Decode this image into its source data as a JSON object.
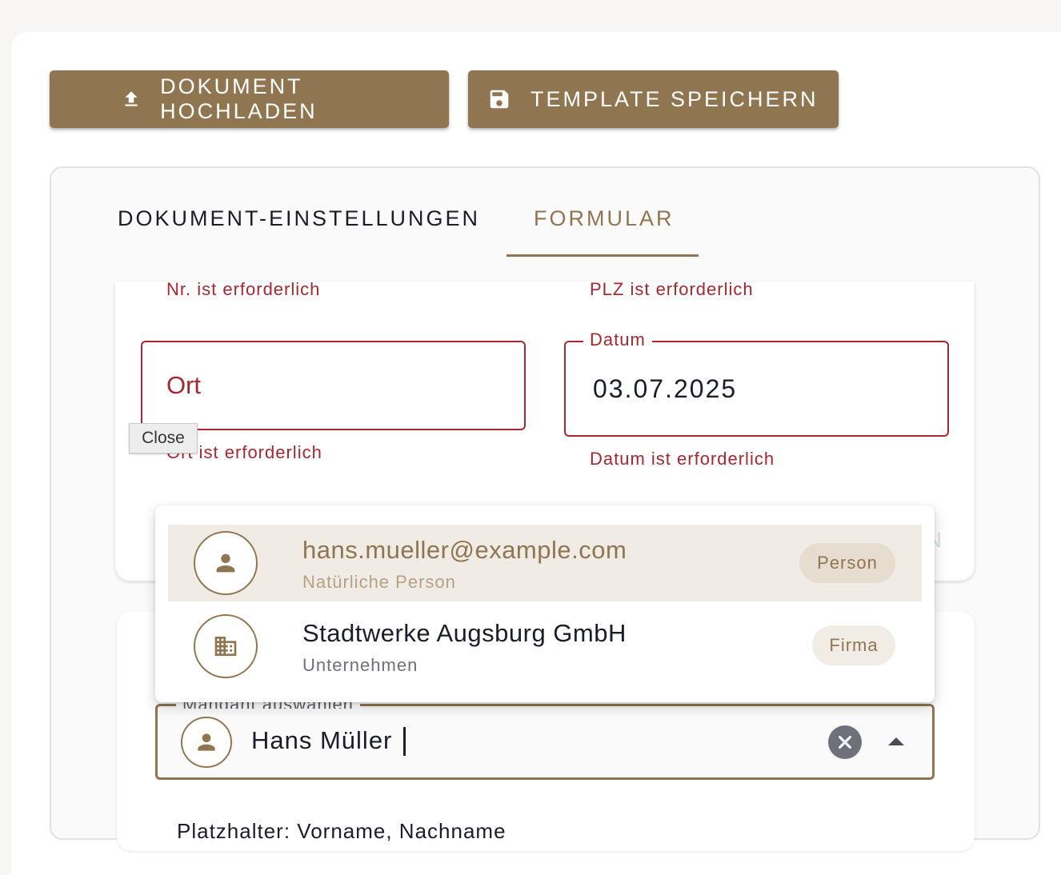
{
  "toolbar": {
    "upload_label": "DOKUMENT HOCHLADEN",
    "save_label": "TEMPLATE SPEICHERN"
  },
  "tabs": [
    {
      "label": "DOKUMENT-EINSTELLUNGEN",
      "active": false
    },
    {
      "label": "FORMULAR",
      "active": true
    }
  ],
  "form": {
    "nr_error": "Nr. ist erforderlich",
    "plz_error": "PLZ ist erforderlich",
    "ort_placeholder": "Ort",
    "ort_error": "Ort ist erforderlich",
    "datum_label": "Datum",
    "datum_value": "03.07.2025",
    "datum_error": "Datum ist erforderlich",
    "faint_text": "N"
  },
  "tooltip": "Close",
  "client_select": {
    "label": "Mandant auswählen",
    "value": "Hans Müller",
    "options": [
      {
        "title": "hans.mueller@example.com",
        "subtitle": "Natürliche Person",
        "chip": "Person",
        "icon": "person-icon",
        "highlighted": true
      },
      {
        "title": "Stadtwerke Augsburg GmbH",
        "subtitle": "Unternehmen",
        "chip": "Firma",
        "icon": "building-icon",
        "highlighted": false
      }
    ]
  },
  "placeholder_hint": "Platzhalter: Vorname, Nachname",
  "colors": {
    "accent": "#8f7650",
    "error": "#a6272f",
    "text": "#1a1d2a"
  }
}
